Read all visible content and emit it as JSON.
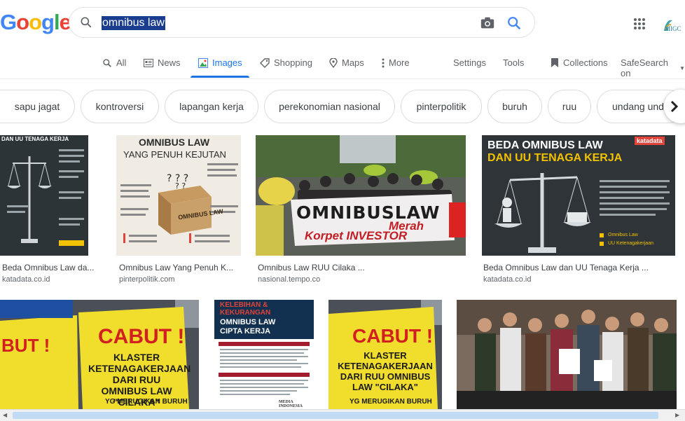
{
  "logo": {
    "letters": [
      "G",
      "o",
      "o",
      "g",
      "l",
      "e"
    ],
    "colors": [
      "#4285F4",
      "#EA4335",
      "#FBBC05",
      "#4285F4",
      "#34A853",
      "#EA4335"
    ]
  },
  "search": {
    "query": "omnibus law"
  },
  "account": {
    "avatar_text": "MIGC"
  },
  "tabs": {
    "all": "All",
    "news": "News",
    "images": "Images",
    "shopping": "Shopping",
    "maps": "Maps",
    "more": "More",
    "settings": "Settings",
    "tools": "Tools",
    "collections": "Collections",
    "safesearch": "SafeSearch on"
  },
  "chips": [
    "sapu jagat",
    "kontroversi",
    "lapangan kerja",
    "perekonomian nasional",
    "pinterpolitik",
    "buruh",
    "ruu",
    "undang und"
  ],
  "results": [
    {
      "title": "Beda Omnibus Law da...",
      "source": "katadata.co.id"
    },
    {
      "title": "Omnibus Law Yang Penuh K...",
      "source": "pinterpolitik.com"
    },
    {
      "title": "Omnibus Law RUU Cilaka ...",
      "source": "nasional.tempo.co"
    },
    {
      "title": "Beda Omnibus Law dan UU Tenaga Kerja ...",
      "source": "katadata.co.id"
    }
  ],
  "thumb_text": {
    "t1_header": "DAN UU TENAGA KERJA",
    "t2_title1": "OMNIBUS LAW",
    "t2_title2": "YANG PENUH KEJUTAN",
    "t2_box": "OMNIBUS LAW",
    "t3_banner1": "OMNIBUSLAW",
    "t3_banner2": "Merah",
    "t3_banner3": "Korpet INVESTOR",
    "t4_title1": "BEDA OMNIBUS LAW",
    "t4_title2": "DAN UU TENAGA KERJA",
    "t4_brand": "katadata",
    "t4_footer1": "Omnibus Law",
    "t4_footer2": "UU Ketenagakerjaan",
    "r2_a_cabut": "CABUT !",
    "r2_a_sign": "KLASTER KETENAGAKERJAAN DARI RUU OMNIBUS LAW \"CILAKA\"",
    "r2_a_bottom": "YG MERUGIKAN BURUH",
    "r2_a_left": "BUT !",
    "r2_b_title1": "KELEBIHAN &",
    "r2_b_title2": "KEKURANGAN",
    "r2_b_title3": "OMNIBUS LAW",
    "r2_b_title4": "CIPTA KERJA",
    "r2_b_brand": "MEDIA INDONESIA",
    "r2_c_cabut": "CABUT !",
    "r2_c_sign": "KLASTER KETENAGAKERJAAN DARI RUU OMNIBUS LAW \"CILAKA\"",
    "r2_c_bottom": "YG MERUGIKAN BURUH"
  }
}
